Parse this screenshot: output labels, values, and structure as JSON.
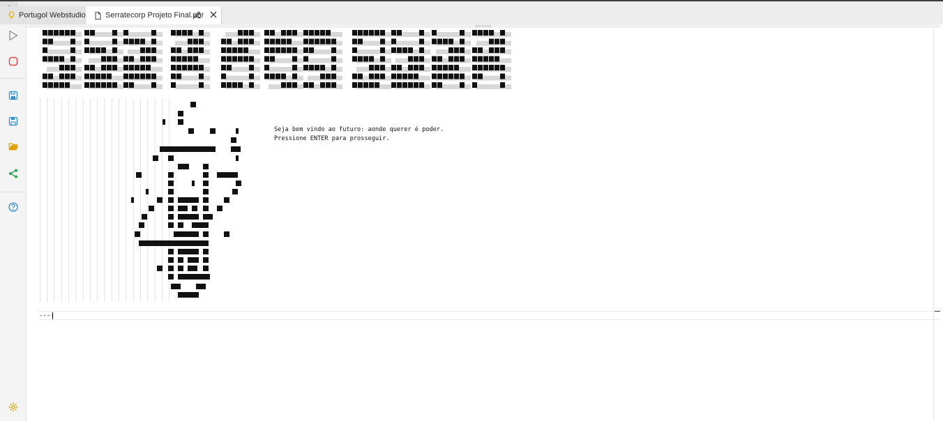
{
  "tabs": [
    {
      "label": "Portugol Webstudio",
      "icon": "lightbulb-icon",
      "active": false
    },
    {
      "label": "Serratecorp Projeto Final.por",
      "icon": "file-icon",
      "active": true
    }
  ],
  "toolbar": {
    "items": [
      "play-icon",
      "stop-icon",
      "save-icon",
      "save-as-icon",
      "folder-open-icon",
      "share-icon",
      "help-icon",
      "settings-icon"
    ]
  },
  "console": {
    "banner_ascii": "SERRATECORP",
    "message_line1": "Seja bem vindo ao futuro: aonde querer é poder.",
    "message_line2": "Pressione ENTER para prosseguir.",
    "input_text": "----"
  },
  "colors": {
    "accent_blue": "#2f8fce",
    "stop_red": "#e04545",
    "folder_yellow": "#e0a100",
    "share_green": "#2aa54a",
    "settings_yellow": "#d9a400",
    "bulb_yellow": "#e5b400"
  }
}
